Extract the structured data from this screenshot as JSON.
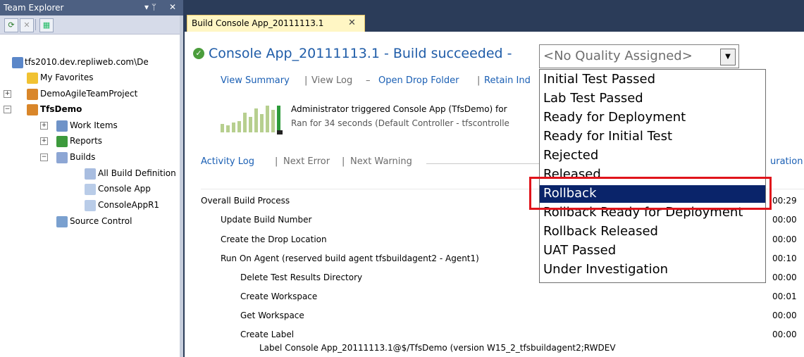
{
  "team_explorer": {
    "title": "Team Explorer",
    "pin_glyph": "▾ ᛘ",
    "close_glyph": "✕",
    "server": "tfs2010.dev.repliweb.com\\De",
    "tree": {
      "my_favorites": "My Favorites",
      "demo_agile": "DemoAgileTeamProject",
      "tfsdemo": "TfsDemo",
      "work_items": "Work Items",
      "reports": "Reports",
      "builds": "Builds",
      "all_build_defs": "All Build Definition",
      "console_app": "Console App",
      "console_app_r1": "ConsoleAppR1",
      "source_control": "Source Control"
    }
  },
  "tab": {
    "title": "Build Console App_20111113.1",
    "close": "✕"
  },
  "build": {
    "title": "Console App_20111113.1 - Build succeeded -",
    "quality_value": "<No Quality Assigned>",
    "links": {
      "view_summary": "View Summary",
      "sep1": "|",
      "view_log": "View Log",
      "dash": "–",
      "open_drop": "Open Drop Folder",
      "sep2": "|",
      "retain": "Retain Ind"
    },
    "trigger_line": "Administrator triggered Console App (TfsDemo) for",
    "ran_line": "Ran for 34 seconds (Default Controller - tfscontrolle"
  },
  "activity": {
    "activity_log": "Activity Log",
    "sep1": "|",
    "next_error": "Next Error",
    "sep2": "|",
    "next_warning": "Next Warning",
    "duration_header": "uration"
  },
  "rows": [
    {
      "name": "Overall Build Process",
      "dur": "00:29"
    },
    {
      "name": "Update Build Number",
      "dur": "00:00"
    },
    {
      "name": "Create the Drop Location",
      "dur": "00:00"
    },
    {
      "name": "Run On Agent (reserved build agent tfsbuildagent2 - Agent1)",
      "dur": "00:10"
    },
    {
      "name": "Delete Test Results Directory",
      "dur": "00:00"
    },
    {
      "name": "Create Workspace",
      "dur": "00:01"
    },
    {
      "name": "Get Workspace",
      "dur": "00:00"
    },
    {
      "name": "Create Label",
      "dur": "00:00"
    },
    {
      "name": "Label Console App_20111113.1@$/TfsDemo (version W15_2_tfsbuildagent2;RWDEV",
      "dur": ""
    }
  ],
  "quality_options": [
    "Initial Test Passed",
    "Lab Test Passed",
    "Ready for Deployment",
    "Ready for Initial Test",
    "Rejected",
    "Released",
    "Rollback",
    "Rollback Ready for Deployment",
    "Rollback Released",
    "UAT Passed",
    "Under Investigation"
  ],
  "quality_selected": "Rollback",
  "colors": {
    "accent": "#1f5ca8",
    "selection": "#0a246a",
    "highlight": "#e0141b"
  }
}
